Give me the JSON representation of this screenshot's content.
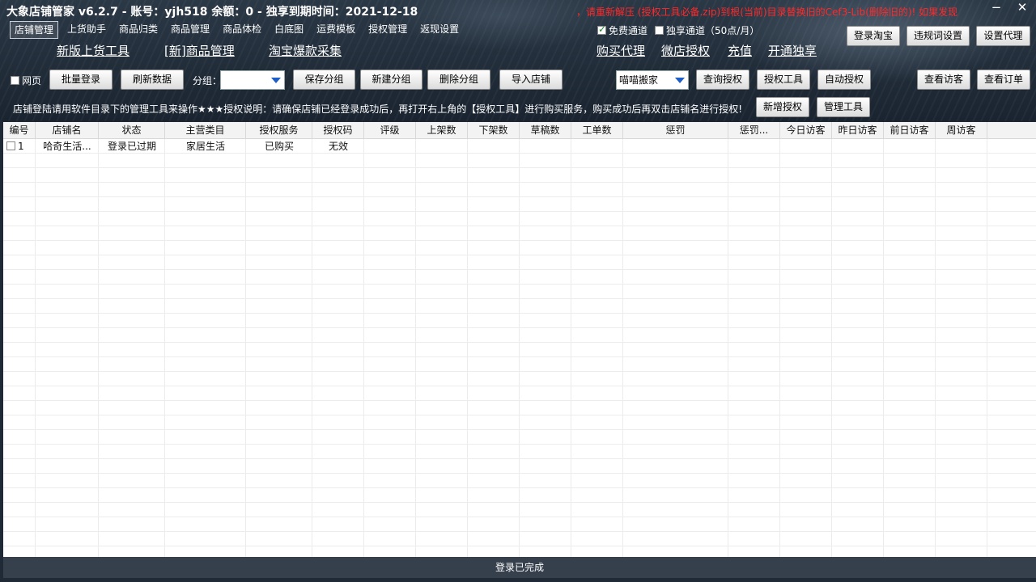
{
  "window": {
    "title": "大象店铺管家 v6.2.7 - 账号：yjh518 余额：0 - 独享到期时间：2021-12-18",
    "marquee": "，请重新解压 (授权工具必备.zip)到根(当前)目录替换旧的Cef3-Lib(删除旧的)!     如果发现",
    "minimize": "−",
    "close": "✕"
  },
  "menu": [
    "店铺管理",
    "上货助手",
    "商品归类",
    "商品管理",
    "商品体检",
    "白底图",
    "运费模板",
    "授权管理",
    "返现设置"
  ],
  "links_left": [
    "新版上货工具",
    "[新]商品管理",
    "淘宝爆款采集"
  ],
  "links_right": [
    "购买代理",
    "微店授权",
    "充值",
    "开通独享"
  ],
  "channels": {
    "free": "免费通道",
    "exclusive": "独享通道（50点/月）"
  },
  "top_buttons": {
    "login_taobao": "登录淘宝",
    "banned_words": "违规词设置",
    "proxy": "设置代理"
  },
  "toolbar": {
    "webpage": "网页",
    "batch_login": "批量登录",
    "refresh": "刷新数据",
    "group_label": "分组：",
    "group_value": "",
    "save_group": "保存分组",
    "new_group": "新建分组",
    "delete_group": "删除分组",
    "import_shop": "导入店铺",
    "platform": "喵喵搬家",
    "query_auth": "查询授权",
    "auth_tool": "授权工具",
    "auto_auth": "自动授权",
    "view_visitors": "查看访客",
    "view_orders": "查看订单",
    "new_auth": "新增授权",
    "manage_tool": "管理工具"
  },
  "notice": "店铺登陆请用软件目录下的管理工具来操作★★★授权说明：请确保店铺已经登录成功后，再打开右上角的【授权工具】进行购买服务，购买成功后再双击店铺名进行授权!",
  "table": {
    "columns": [
      "编号",
      "店铺名",
      "状态",
      "主营类目",
      "授权服务",
      "授权码",
      "评级",
      "上架数",
      "下架数",
      "草稿数",
      "工单数",
      "惩罚",
      "惩罚...",
      "今日访客",
      "昨日访客",
      "前日访客",
      "周访客"
    ],
    "rows": [
      {
        "id": "1",
        "shop": "哈奇生活...",
        "status": "登录已过期",
        "category": "家居生活",
        "service": "已购买",
        "code": "无效"
      }
    ]
  },
  "status": "登录已完成"
}
